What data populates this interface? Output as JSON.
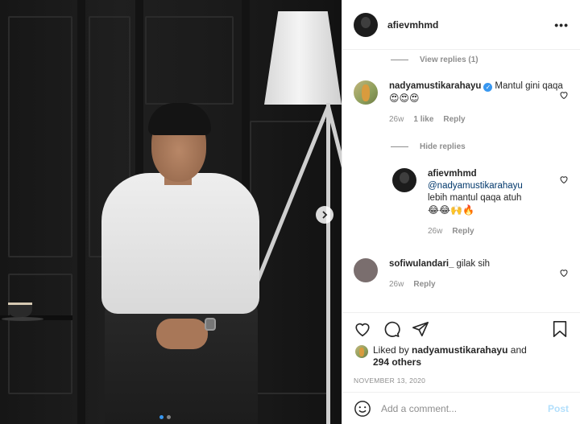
{
  "post": {
    "author": "afievmhmd",
    "date": "NOVEMBER 13, 2020"
  },
  "comments": {
    "view_replies_1": "View replies (1)",
    "c1": {
      "user": "nadyamustikarahayu",
      "text": "Mantul gini qaqa",
      "emoji": "😍😍😍",
      "age": "26w",
      "likes": "1 like",
      "reply": "Reply"
    },
    "hide_replies": "Hide replies",
    "r1": {
      "user": "afievmhmd",
      "mention": "@nadyamustikarahayu",
      "text": "lebih mantul qaqa atuh",
      "emoji": "😂😂🙌🔥",
      "age": "26w",
      "reply": "Reply"
    },
    "c2": {
      "user": "sofiwulandari_",
      "text": "gilak sih",
      "age": "26w",
      "reply": "Reply"
    }
  },
  "likes": {
    "prefix": "Liked by",
    "user": "nadyamustikarahayu",
    "and": "and",
    "others": "294 others"
  },
  "add_comment": {
    "placeholder": "Add a comment...",
    "post_label": "Post"
  },
  "carousel": {
    "slides": 2,
    "active": 1
  },
  "icons": [
    "more-icon",
    "heart-icon",
    "comment-icon",
    "share-icon",
    "save-icon",
    "emoji-icon",
    "next-arrow-icon",
    "verified-icon"
  ],
  "colors": {
    "accent": "#3897f0",
    "muted": "#8e8e8e",
    "post_disabled": "#b2dffc"
  }
}
